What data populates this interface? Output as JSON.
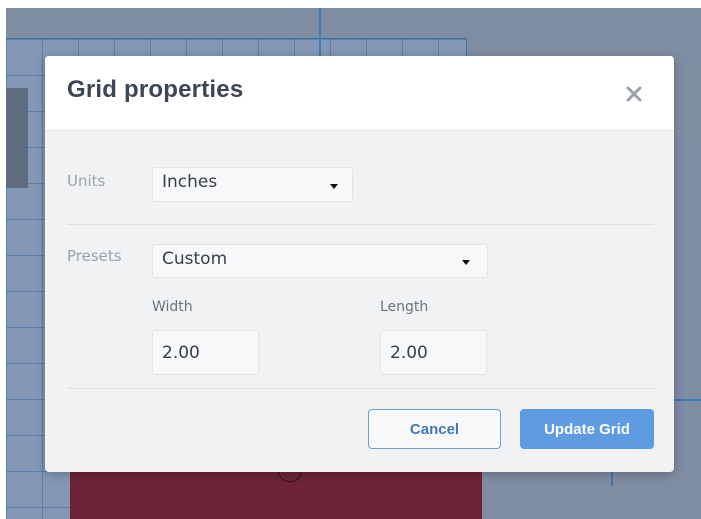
{
  "dialog": {
    "title": "Grid properties",
    "close_icon": "close-icon"
  },
  "units": {
    "label": "Units",
    "selected": "Inches",
    "caret_icon": "caret-down-icon"
  },
  "presets": {
    "label": "Presets",
    "selected": "Custom",
    "caret_icon": "caret-down-icon"
  },
  "width": {
    "label": "Width",
    "value": "2.00"
  },
  "length": {
    "label": "Length",
    "value": "2.00"
  },
  "buttons": {
    "cancel": "Cancel",
    "update": "Update Grid"
  },
  "colors": {
    "accent": "#5f9be0",
    "title_text": "#3d4653",
    "design_shape": "#6d2438",
    "canvas_backdrop": "#7f8da3"
  }
}
